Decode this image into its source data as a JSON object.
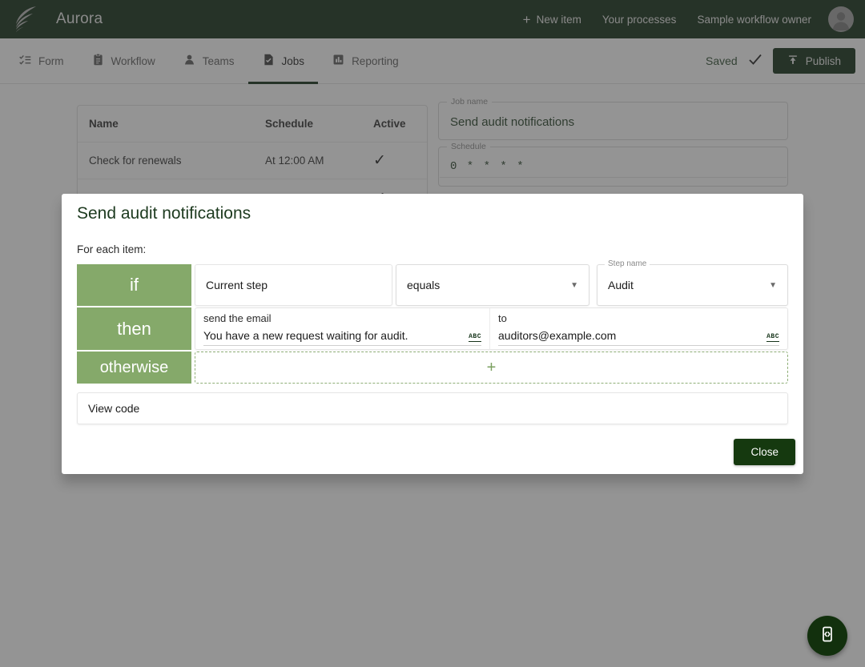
{
  "topbar": {
    "brand": "Aurora",
    "new_item": "New item",
    "your_processes": "Your processes",
    "owner": "Sample workflow owner",
    "bg_color": "#0d2810"
  },
  "nav": {
    "items": [
      {
        "label": "Form",
        "icon": "checklist-icon",
        "active": false
      },
      {
        "label": "Workflow",
        "icon": "clipboard-icon",
        "active": false
      },
      {
        "label": "Teams",
        "icon": "person-icon",
        "active": false
      },
      {
        "label": "Jobs",
        "icon": "job-document-icon",
        "active": true
      },
      {
        "label": "Reporting",
        "icon": "bar-chart-icon",
        "active": false
      }
    ],
    "saved_label": "Saved",
    "publish_label": "Publish"
  },
  "jobs_table": {
    "headers": {
      "name": "Name",
      "schedule": "Schedule",
      "active": "Active"
    },
    "rows": [
      {
        "name": "Check for renewals",
        "schedule": "At 12:00 AM",
        "active": "✓"
      },
      {
        "name": "",
        "schedule": "",
        "active": "✓"
      }
    ]
  },
  "job_form": {
    "job_name_legend": "Job name",
    "job_name_value": "Send audit notifications",
    "schedule_legend": "Schedule",
    "schedule_value": "0 * * * *"
  },
  "modal": {
    "title": "Send audit notifications",
    "subtitle": "For each item:",
    "rules": {
      "if_keyword": "if",
      "if_field": "Current step",
      "if_operator": "equals",
      "step_name_legend": "Step name",
      "step_name_value": "Audit",
      "then_keyword": "then",
      "send_email_label": "send the email",
      "email_body": "You have a new request waiting for audit.",
      "to_label": "to",
      "to_value": "auditors@example.com",
      "spellcheck_badge": "ABC",
      "otherwise_keyword": "otherwise",
      "add_action_icon": "plus-icon"
    },
    "view_code_label": "View code",
    "close_label": "Close"
  },
  "fab": {
    "icon": "mobile-code-preview-icon"
  },
  "colors": {
    "brand_dark_green": "#0d2810",
    "keyword_green": "#85a96a",
    "accent_green": "#7aa05f",
    "close_button": "#15390f",
    "overlay": "rgba(60,60,60,0.55)"
  }
}
